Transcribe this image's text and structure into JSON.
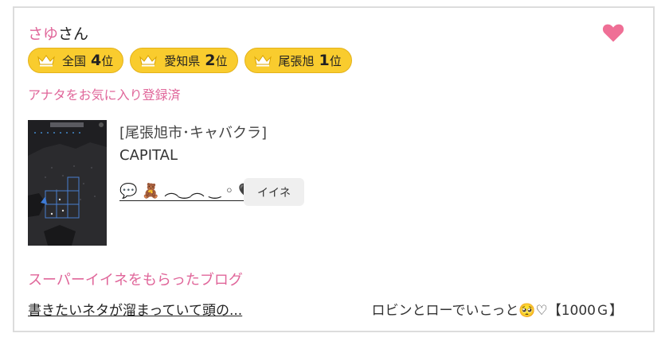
{
  "user": {
    "name": "さゆ",
    "suffix": "さん"
  },
  "favorite_icon": "heart-icon",
  "colors": {
    "accent_pink": "#e0669a",
    "badge_yellow": "#f9cc2e"
  },
  "badges": [
    {
      "icon": "crown-icon",
      "area": "全国",
      "rank": "4",
      "unit": "位"
    },
    {
      "icon": "crown-icon",
      "area": "愛知県",
      "rank": "2",
      "unit": "位"
    },
    {
      "icon": "crown-icon",
      "area": "尾張旭",
      "rank": "1",
      "unit": "位"
    }
  ],
  "favorite_status": "アナタをお気に入り登録済",
  "shop": {
    "category": "[尾張旭市･キャバクラ]",
    "name": "CAPITAL",
    "comment": "💬 🧸 ︵‿︵ ‿ ◦ 🖤",
    "like_label": "イイネ"
  },
  "section": {
    "title": "スーパーイイネをもらったブログ"
  },
  "blog": {
    "title": "書きたいネタが溜まっていて頭の...",
    "meta": "ロビンとローでいこっと🥺♡【1000Ｇ】"
  }
}
